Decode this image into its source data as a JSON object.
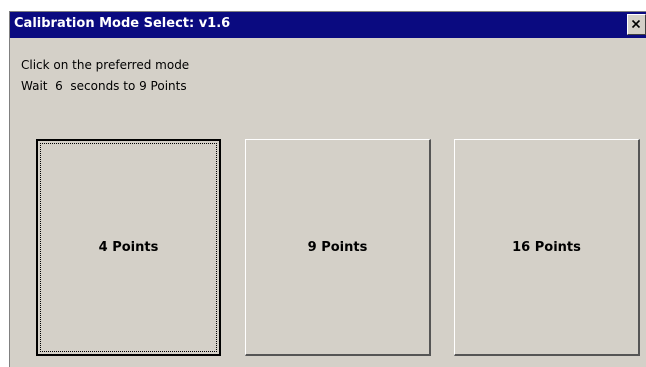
{
  "window": {
    "title": "Calibration Mode Select: v1.6",
    "close_icon": "close-icon"
  },
  "instructions": {
    "line1": "Click on the preferred mode",
    "line2": "Wait  6  seconds to 9 Points"
  },
  "modes": {
    "four": "4 Points",
    "nine": "9 Points",
    "sixteen": "16 Points",
    "focused": "4 Points"
  },
  "colors": {
    "titlebar": "#0a0a80",
    "face": "#d4d0c8"
  }
}
